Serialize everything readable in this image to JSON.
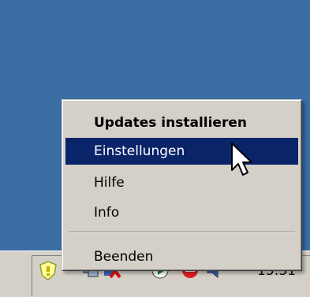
{
  "menu": {
    "items": [
      {
        "label": "Updates installieren",
        "default": true
      },
      {
        "label": "Einstellungen",
        "selected": true
      },
      {
        "label": "Hilfe"
      },
      {
        "label": "Info"
      },
      {
        "label": "Beenden"
      }
    ]
  },
  "tray": {
    "clock": "15:31",
    "icons": [
      "updates-shield-icon",
      "network-icon",
      "security-alert-icon",
      "media-play-icon",
      "antivirus-icon",
      "volume-icon"
    ]
  },
  "colors": {
    "desktop": "#3a6ea5",
    "menu_face": "#d4d0c8",
    "selection": "#0a246a"
  }
}
